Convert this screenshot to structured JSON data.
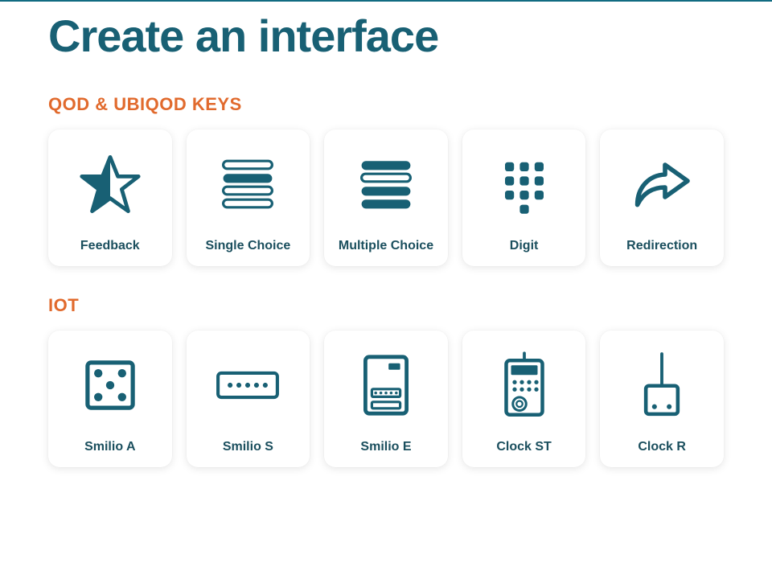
{
  "page": {
    "title": "Create an interface"
  },
  "sections": {
    "qod": {
      "title": "QOD & UBIQOD KEYS",
      "cards": [
        {
          "label": "Feedback"
        },
        {
          "label": "Single Choice"
        },
        {
          "label": "Multiple Choice"
        },
        {
          "label": "Digit"
        },
        {
          "label": "Redirection"
        }
      ]
    },
    "iot": {
      "title": "IOT",
      "cards": [
        {
          "label": "Smilio A"
        },
        {
          "label": "Smilio S"
        },
        {
          "label": "Smilio E"
        },
        {
          "label": "Clock ST"
        },
        {
          "label": "Clock R"
        }
      ]
    }
  },
  "colors": {
    "brand_teal": "#186074",
    "accent_orange": "#e16a2d"
  }
}
